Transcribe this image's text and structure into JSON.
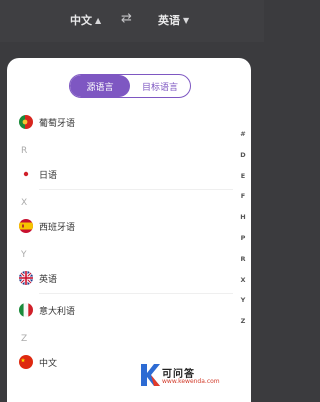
{
  "header": {
    "source_lang": "中文",
    "target_lang": "英语",
    "swap_icon": "⇄",
    "chevron_up": "⌃",
    "chevron_down": "⌄"
  },
  "tabs": [
    {
      "label": "源语言",
      "active": true
    },
    {
      "label": "目标语言",
      "active": false
    }
  ],
  "list": [
    {
      "type": "lang",
      "label": "葡萄牙语",
      "flag": "portugal-flag-icon"
    },
    {
      "type": "section",
      "label": "R"
    },
    {
      "type": "lang",
      "label": "日语",
      "flag": "japan-flag-icon"
    },
    {
      "type": "section",
      "label": "X"
    },
    {
      "type": "lang",
      "label": "西班牙语",
      "flag": "spain-flag-icon"
    },
    {
      "type": "section",
      "label": "Y"
    },
    {
      "type": "lang",
      "label": "英语",
      "flag": "uk-flag-icon"
    },
    {
      "type": "lang",
      "label": "意大利语",
      "flag": "italy-flag-icon"
    },
    {
      "type": "section",
      "label": "Z"
    },
    {
      "type": "lang",
      "label": "中文",
      "flag": "china-flag-icon"
    }
  ],
  "index_letters": [
    "#",
    "D",
    "E",
    "F",
    "H",
    "P",
    "R",
    "X",
    "Y",
    "Z"
  ],
  "watermark": {
    "title": "可问答",
    "url": "www.kewenda.com"
  },
  "colors": {
    "accent": "#7e57c2",
    "header_bg": "#3f3f42"
  }
}
